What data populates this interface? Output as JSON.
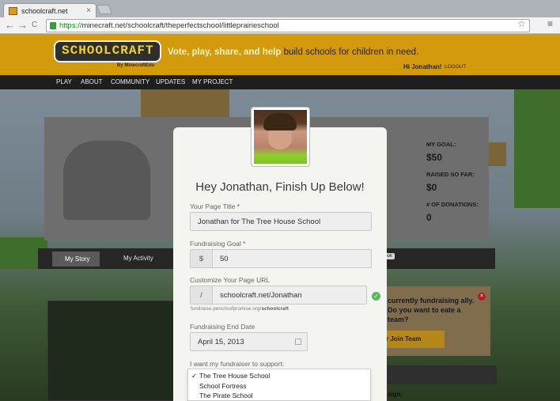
{
  "browser": {
    "tab_title": "schoolcraft.net",
    "url_scheme": "https://",
    "url_rest": "minecraft.net/schoolcraft/theperfectschool/littleprairieschool",
    "tab_close": "×",
    "back": "←",
    "forward": "→",
    "reload": "C",
    "star": "☆",
    "menu": "≡"
  },
  "header": {
    "logo_text": "SCHOOLCRAFT",
    "logo_sub": "By MinecraftEdu",
    "tagline_bold": "Vote, play, share, and help",
    "tagline_rest": "build schools for children in need.",
    "greeting": "Hi Jonathan!",
    "logout": "LOGOUT"
  },
  "nav": {
    "items": [
      "PLAY",
      "ABOUT",
      "COMMUNITY",
      "UPDATES",
      "MY PROJECT"
    ]
  },
  "profile": {
    "goal_label": "MY GOAL:",
    "goal_value": "$50",
    "raised_label": "RAISED SO FAR:",
    "raised_value": "$0",
    "donations_label": "# OF DONATIONS:",
    "donations_value": "0",
    "tab_story": "My Story",
    "tab_activity": "My Activity",
    "sticky_text": "book"
  },
  "promo": {
    "text": "currently fundraising ally. Do you want to eate a team?",
    "button": "r Join Team",
    "close": "×",
    "campaign": "aign:"
  },
  "modal": {
    "title": "Hey Jonathan, Finish Up Below!",
    "page_title_label": "Your Page Title",
    "page_title_value": "Jonathan for The Tree House School",
    "goal_label": "Fundraising Goal",
    "goal_currency": "$",
    "goal_value": "50",
    "url_label": "Customize Your Page URL",
    "url_prefix": "/",
    "url_value": "schoolcraft.net/Jonathan",
    "url_hint_prefix": "fundraise.pencilsofpromise.org/",
    "url_hint_bold": "schoolcraft",
    "end_date_label": "Fundraising End Date",
    "end_date_value": "April 15, 2013",
    "support_label": "I want my fundraiser to support:",
    "required_mark": "*",
    "check": "✓",
    "options": [
      "The Tree House School",
      "School Fortress",
      "The Pirate School"
    ],
    "selected_option": "The Tree House School"
  }
}
